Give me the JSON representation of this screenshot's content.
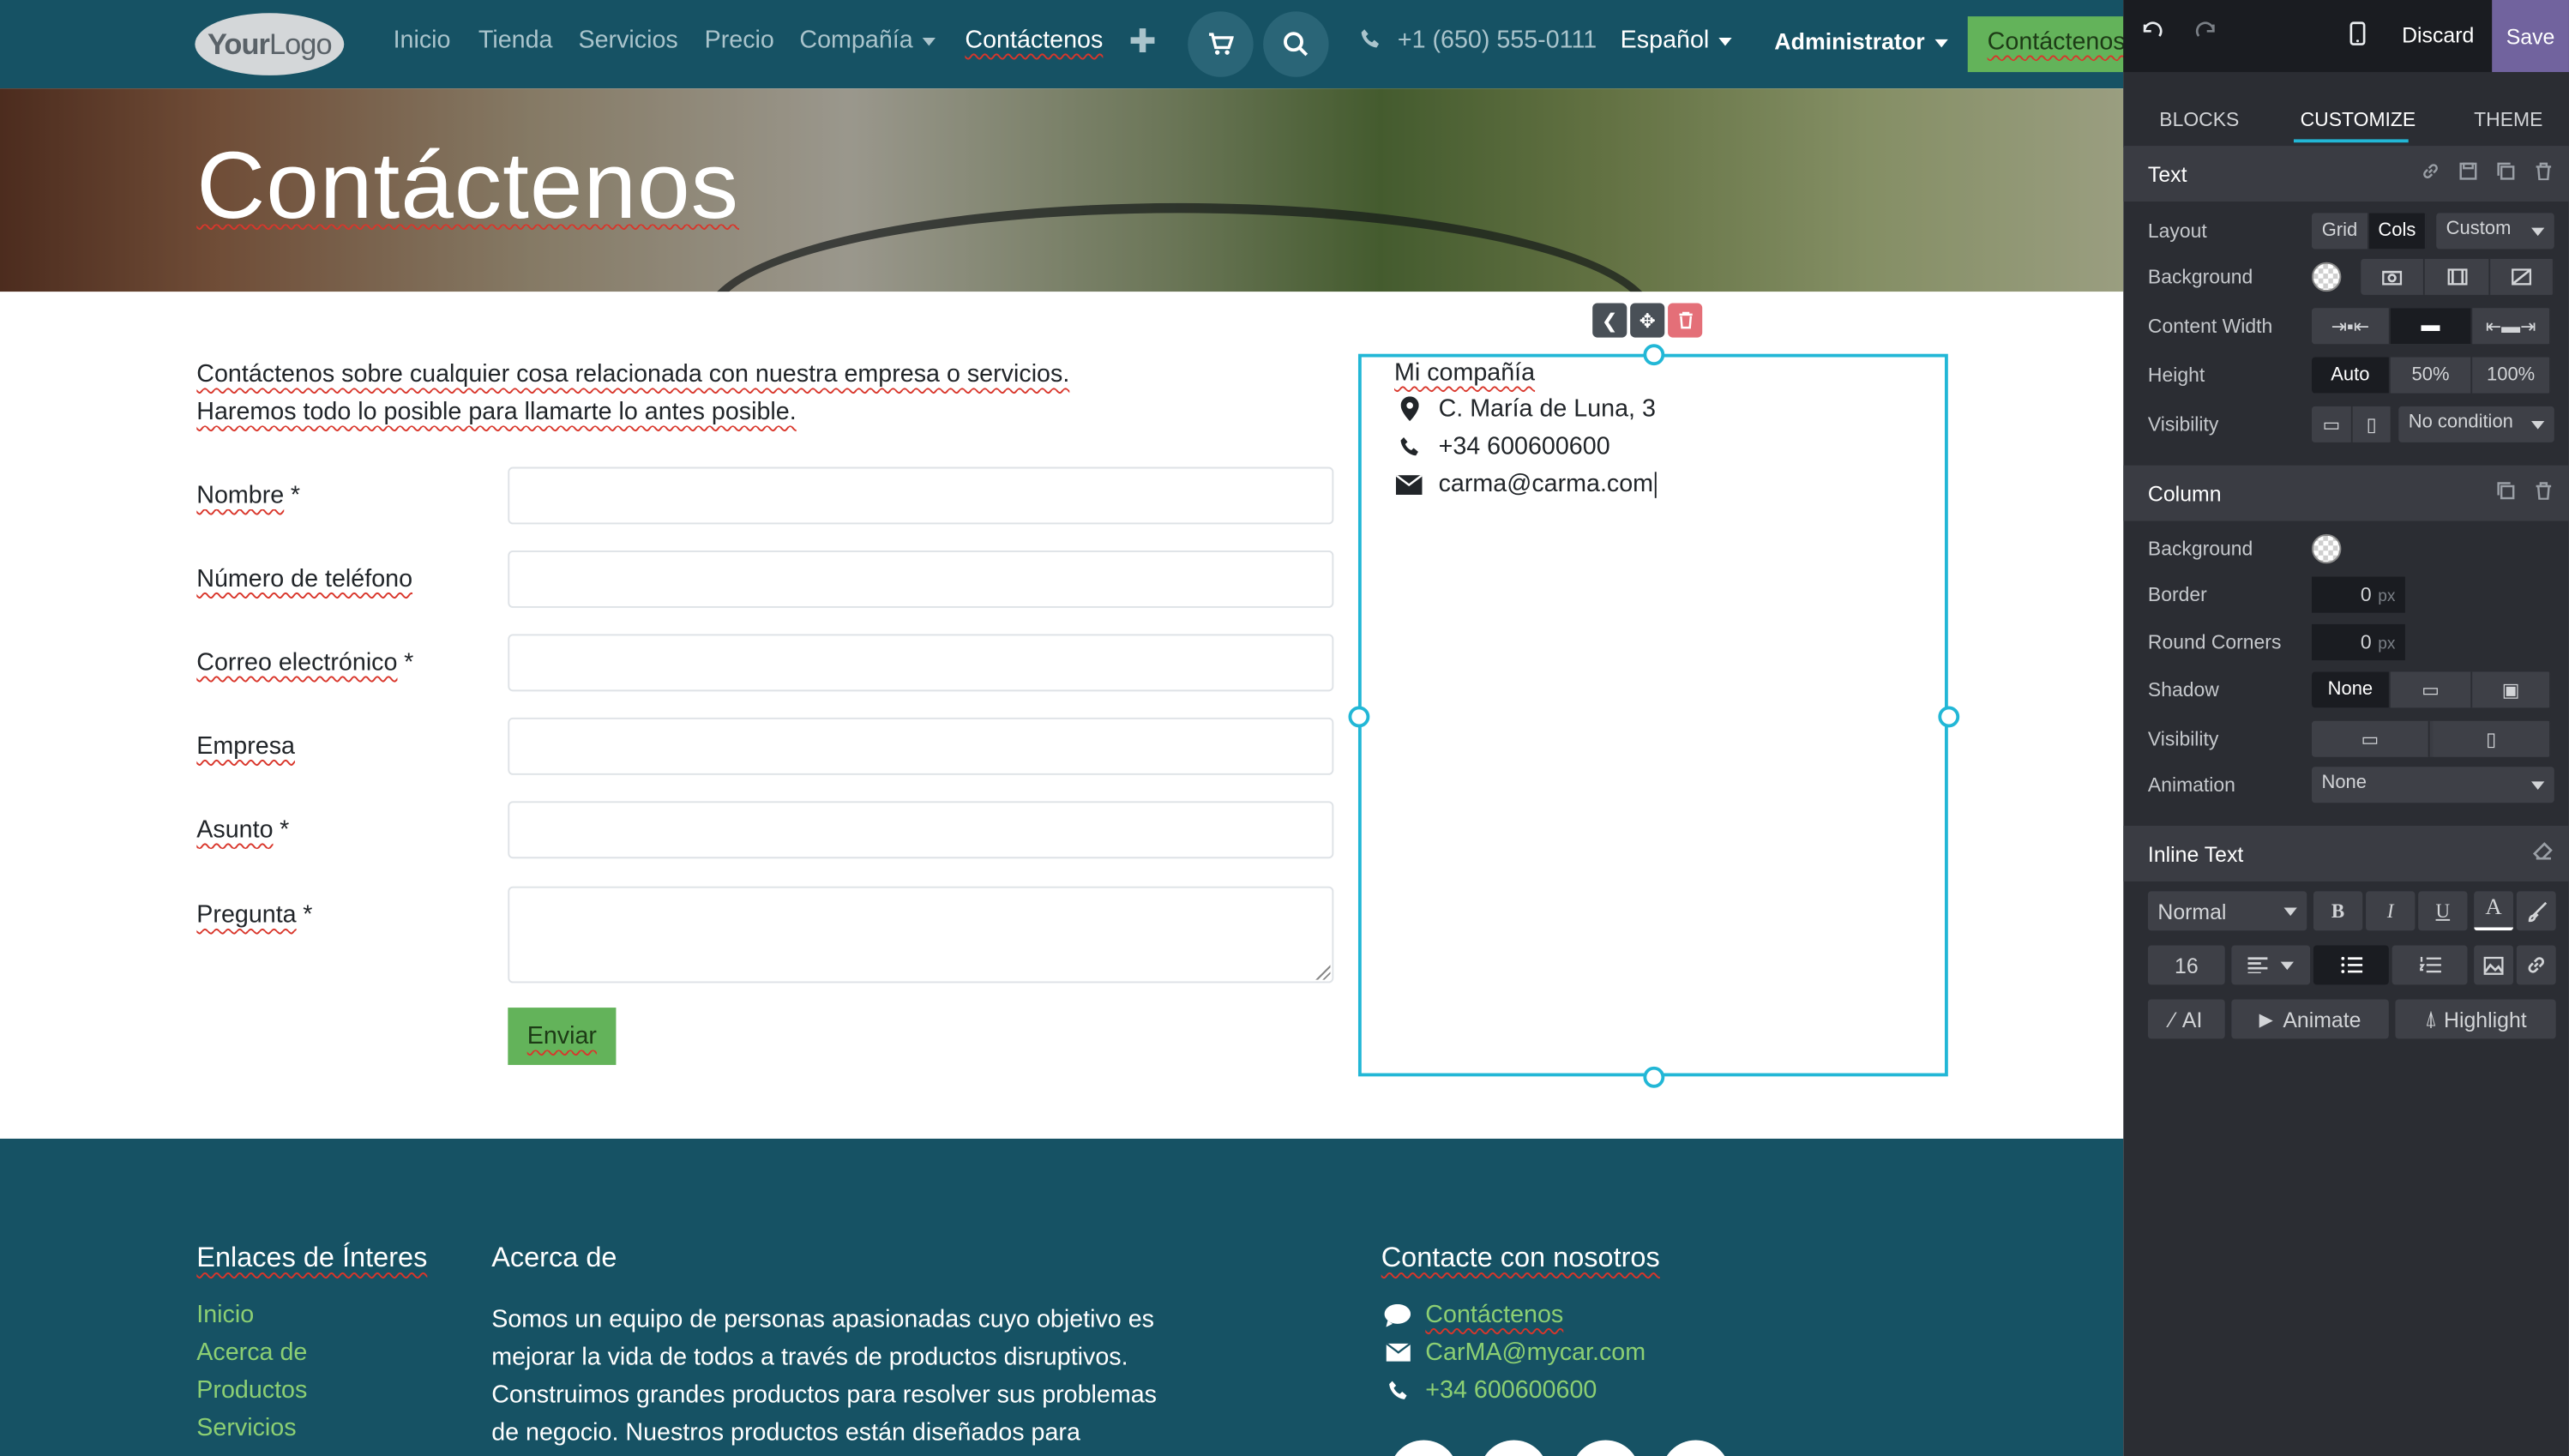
{
  "navbar": {
    "logo_main": "Your",
    "logo_sub": "Logo",
    "links": [
      "Inicio",
      "Tienda",
      "Servicios",
      "Precio",
      "Compañía",
      "Contáctenos"
    ],
    "phone": "+1 (650) 555-0111",
    "language": "Español",
    "user": "Administrator",
    "cta": "Contáctenos"
  },
  "hero": {
    "title": "Contáctenos"
  },
  "intro": {
    "line1": "Contáctenos sobre cualquier cosa relacionada con nuestra empresa o servicios.",
    "line2": "Haremos todo lo posible para llamarte lo antes posible."
  },
  "form": {
    "fields": [
      {
        "label": "Nombre",
        "required": "*"
      },
      {
        "label": "Número de teléfono",
        "required": ""
      },
      {
        "label": "Correo electrónico",
        "required": "*"
      },
      {
        "label": "Empresa",
        "required": ""
      },
      {
        "label": "Asunto",
        "required": "*"
      },
      {
        "label": "Pregunta",
        "required": "*"
      }
    ],
    "submit": "Enviar"
  },
  "company_info": {
    "name": "Mi compañía",
    "address": "C. María de Luna, 3",
    "phone": "+34 600600600",
    "email": "carma@carma.com"
  },
  "footer": {
    "links_title": "Enlaces de Ínteres",
    "links": [
      "Inicio",
      "Acerca de",
      "Productos",
      "Servicios"
    ],
    "about_title": "Acerca de",
    "about_lines": [
      "Somos un equipo de personas apasionadas cuyo objetivo es",
      "mejorar la vida de todos a través de productos disruptivos.",
      "Construimos grandes productos para resolver sus problemas",
      "de negocio. Nuestros productos están diseñados para"
    ],
    "contact_title": "Contacte con nosotros",
    "contact_link": "Contáctenos",
    "contact_email": "CarMA@mycar.com",
    "contact_phone": "+34 600600600"
  },
  "editor": {
    "discard": "Discard",
    "save": "Save",
    "tabs": [
      "BLOCKS",
      "CUSTOMIZE",
      "THEME"
    ],
    "text_section": {
      "title": "Text",
      "layout_label": "Layout",
      "layout_options": [
        "Grid",
        "Cols"
      ],
      "layout_custom": "Custom",
      "background_label": "Background",
      "content_width_label": "Content Width",
      "height_label": "Height",
      "height_options": [
        "Auto",
        "50%",
        "100%"
      ],
      "visibility_label": "Visibility",
      "visibility_value": "No condition"
    },
    "column_section": {
      "title": "Column",
      "background_label": "Background",
      "border_label": "Border",
      "border_value": "0",
      "border_unit": "px",
      "round_label": "Round Corners",
      "round_value": "0",
      "round_unit": "px",
      "shadow_label": "Shadow",
      "shadow_value": "None",
      "visibility_label": "Visibility",
      "animation_label": "Animation",
      "animation_value": "None"
    },
    "inline_section": {
      "title": "Inline Text",
      "style_value": "Normal",
      "bold": "B",
      "italic": "I",
      "underline": "U",
      "color_a": "A",
      "font_size": "16",
      "ai": "AI",
      "animate": "Animate",
      "highlight": "Highlight"
    }
  },
  "colors": {
    "navbar_bg": "#165264",
    "accent_green": "#63b35a",
    "selection": "#22b7d6",
    "panel_bg": "#2b2d33",
    "save_purple": "#71639e"
  }
}
